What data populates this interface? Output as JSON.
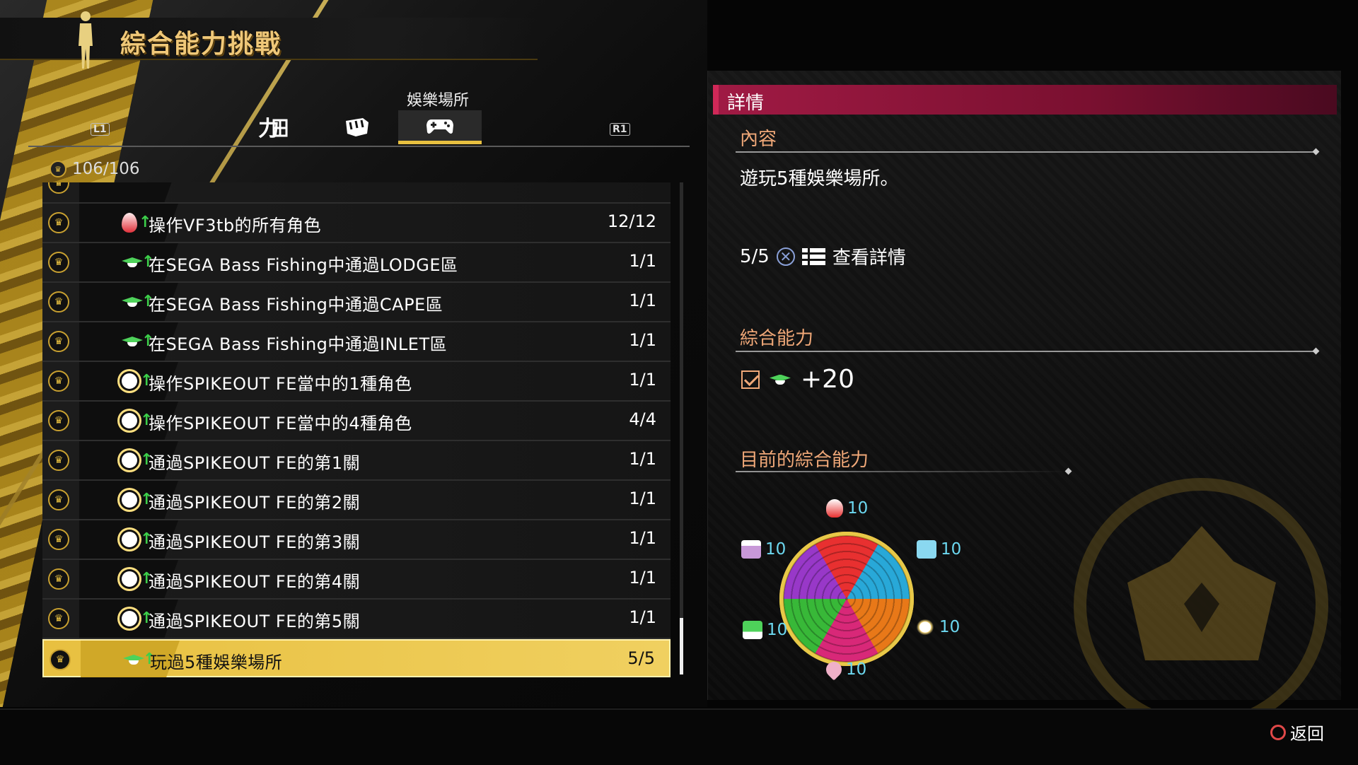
{
  "header": {
    "title": "綜合能力挑戰"
  },
  "tabs": {
    "left_shoulder": "L1",
    "right_shoulder": "R1",
    "active_label": "娛樂場所",
    "items": [
      {
        "icon": "kanji-tab-icon"
      },
      {
        "icon": "fist-tab-icon"
      },
      {
        "icon": "controller-tab-icon"
      }
    ]
  },
  "counter": "106/106",
  "list": [
    {
      "text": "操作VF3tb的所有角色",
      "progress": "12/12",
      "icon": "flame-icon"
    },
    {
      "text": "在SEGA Bass Fishing中通過LODGE區",
      "progress": "1/1",
      "icon": "cap-icon"
    },
    {
      "text": "在SEGA Bass Fishing中通過CAPE區",
      "progress": "1/1",
      "icon": "cap-icon"
    },
    {
      "text": "在SEGA Bass Fishing中通過INLET區",
      "progress": "1/1",
      "icon": "cap-icon"
    },
    {
      "text": "操作SPIKEOUT FE當中的1種角色",
      "progress": "1/1",
      "icon": "sun-icon"
    },
    {
      "text": "操作SPIKEOUT FE當中的4種角色",
      "progress": "4/4",
      "icon": "sun-icon"
    },
    {
      "text": "通過SPIKEOUT FE的第1關",
      "progress": "1/1",
      "icon": "sun-icon"
    },
    {
      "text": "通過SPIKEOUT FE的第2關",
      "progress": "1/1",
      "icon": "sun-icon"
    },
    {
      "text": "通過SPIKEOUT FE的第3關",
      "progress": "1/1",
      "icon": "sun-icon"
    },
    {
      "text": "通過SPIKEOUT FE的第4關",
      "progress": "1/1",
      "icon": "sun-icon"
    },
    {
      "text": "通過SPIKEOUT FE的第5關",
      "progress": "1/1",
      "icon": "sun-icon"
    },
    {
      "text": "玩過5種娛樂場所",
      "progress": "5/5",
      "icon": "cap-icon",
      "selected": true
    }
  ],
  "detail": {
    "header": "詳情",
    "content_title": "內容",
    "description": "遊玩5種娛樂場所。",
    "progress": "5/5",
    "view_details": "查看詳情",
    "ability_title": "綜合能力",
    "bonus": "+20",
    "current_title": "目前的綜合能力",
    "stats": {
      "top": "10",
      "top_right": "10",
      "bottom_right": "10",
      "bottom": "10",
      "bottom_left": "10",
      "top_left": "10"
    }
  },
  "footer": {
    "back": "返回"
  },
  "colors": {
    "accent": "#e8c040",
    "detail_header": "#a01a44",
    "section_title": "#f0a878",
    "stat_text": "#6cd8f0"
  }
}
